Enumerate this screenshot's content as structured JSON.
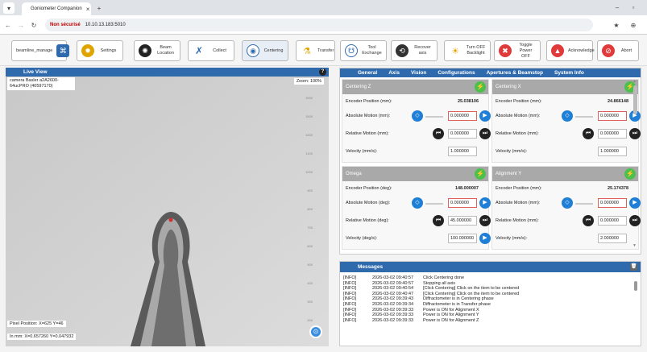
{
  "browser": {
    "tab_title": "Goniometer Companion",
    "url_warning": "Non sécurisé",
    "url": "10.10.13.183:5010"
  },
  "toolbar": {
    "beamline": "beamline_manage",
    "settings": "Settings",
    "beam_location": [
      "Beam",
      "Location"
    ],
    "collect": "Collect",
    "centering": "Centering",
    "transfer": "Transfer",
    "tool_exchange": [
      "Tool",
      "Exchange"
    ],
    "recover_axis": "Recover axis",
    "turn_off_backlight": [
      "Turn OFF",
      "Backlight"
    ],
    "toggle_power_off": [
      "Toggle",
      "Power OFF"
    ],
    "acknowledge": "Acknowledge",
    "abort": "Abort"
  },
  "liveview": {
    "title": "Live View",
    "camera": "camera Basler a2A2600-64ucPRO (40597170)",
    "zoom": "Zoom: 100%",
    "scale_ticks": [
      "1000",
      "1500",
      "1000",
      "1100",
      "1000",
      "900",
      "800",
      "700",
      "600",
      "500",
      "400",
      "300",
      "200"
    ],
    "pixel_position": "Pixel Position: X=625 Y=46",
    "in_mm": "In mm: X=0.657260 Y=0.047932"
  },
  "nav": {
    "tabs": [
      "General",
      "Axis",
      "Vision",
      "Configurations",
      "Apertures & Beamstop",
      "System Info"
    ]
  },
  "axes": [
    {
      "title": "Centering Z",
      "encoder_label": "Encoder Position (mm):",
      "encoder": "25.038106",
      "abs_label": "Absolute Motion (mm):",
      "abs": "0.000000",
      "rel_label": "Relative Motion (mm):",
      "rel": "0.000000",
      "vel_label": "Velocity (mm/s):",
      "vel": "1.000000"
    },
    {
      "title": "Centering X",
      "encoder_label": "Encoder Position (mm):",
      "encoder": "24.866148",
      "abs_label": "Absolute Motion (mm):",
      "abs": "0.000000",
      "rel_label": "Relative Motion (mm):",
      "rel": "0.000000",
      "vel_label": "Velocity (mm/s):",
      "vel": "1.000000"
    },
    {
      "title": "Omega",
      "encoder_label": "Encoder Position (deg):",
      "encoder": "148.000007",
      "abs_label": "Absolute Motion (deg):",
      "abs": "0.000000",
      "rel_label": "Relative Motion (deg):",
      "rel": "45.000000",
      "vel_label": "Velocity (deg/s):",
      "vel": "100.000000"
    },
    {
      "title": "Alignment Y",
      "encoder_label": "Encoder Position (mm):",
      "encoder": "25.174378",
      "abs_label": "Absolute Motion (mm):",
      "abs": "0.000000",
      "rel_label": "Relative Motion (mm):",
      "rel": "0.000000",
      "vel_label": "Velocity (mm/s):",
      "vel": "2.000000"
    }
  ],
  "messages": {
    "title": "Messages",
    "rows": [
      [
        "[INFO]",
        "2026-03-02 09:40:57",
        "Click Centering done"
      ],
      [
        "[INFO]",
        "2026-03-02 09:40:57",
        "Stopping all axis"
      ],
      [
        "[INFO]",
        "2026-03-02 09:40:54",
        "[Click Centering] Click on the item to be centered"
      ],
      [
        "[INFO]",
        "2026-03-02 09:40:47",
        "[Click Centering] Click on the item to be centered"
      ],
      [
        "[INFO]",
        "2026-03-02 09:39:43",
        "Diffractometer is in Centering phase"
      ],
      [
        "[INFO]",
        "2026-03-02 09:39:34",
        "Diffractometer is in Transfer phase"
      ],
      [
        "[INFO]",
        "2026-03-02 09:39:33",
        "Power is ON for Alignment X"
      ],
      [
        "[INFO]",
        "2026-03-02 09:39:33",
        "Power is ON for Alignment Y"
      ],
      [
        "[INFO]",
        "2026-03-02 09:39:33",
        "Power is ON for Alignment Z"
      ]
    ]
  },
  "colors": {
    "header_blue": "#2f6aad",
    "button_blue": "#1f7fd6",
    "bolt_green": "#4cc04c",
    "abort_red": "#e03a3a"
  }
}
